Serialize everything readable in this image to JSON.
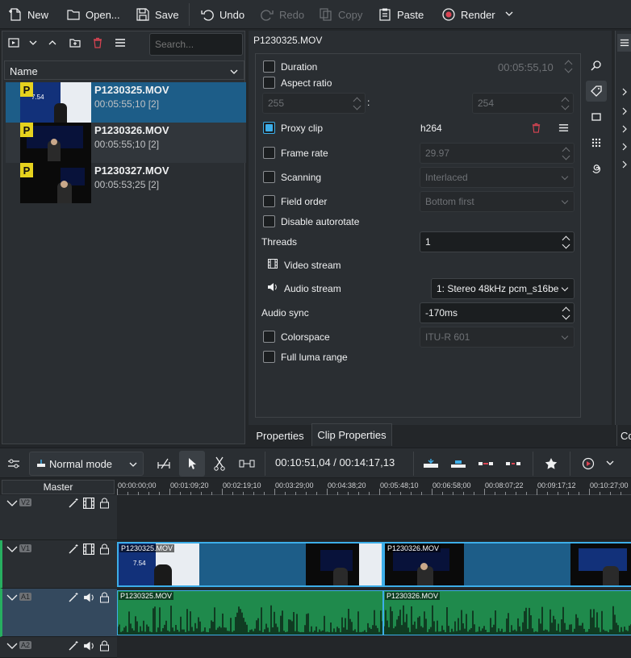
{
  "toolbar": {
    "new": "New",
    "open": "Open...",
    "save": "Save",
    "undo": "Undo",
    "redo": "Redo",
    "copy": "Copy",
    "paste": "Paste",
    "render": "Render"
  },
  "bin": {
    "search_placeholder": "Search...",
    "column_name": "Name",
    "items": [
      {
        "name": "P1230325.MOV",
        "duration": "00:05:55;10 [2]",
        "badge": "P",
        "thumb_text": "7.54"
      },
      {
        "name": "P1230326.MOV",
        "duration": "00:05:55;10 [2]",
        "badge": "P",
        "thumb_text": ""
      },
      {
        "name": "P1230327.MOV",
        "duration": "00:05:53;25 [2]",
        "badge": "P",
        "thumb_text": ""
      }
    ]
  },
  "props": {
    "title": "P1230325.MOV",
    "duration_label": "Duration",
    "duration_value": "00:05:55,10",
    "aspect_label": "Aspect ratio",
    "aspect_w": "255",
    "aspect_sep": ":",
    "aspect_h": "254",
    "proxy_label": "Proxy clip",
    "proxy_value": "h264",
    "framerate_label": "Frame rate",
    "framerate_value": "29.97",
    "scanning_label": "Scanning",
    "scanning_value": "Interlaced",
    "fieldorder_label": "Field order",
    "fieldorder_value": "Bottom first",
    "autorotate_label": "Disable autorotate",
    "threads_label": "Threads",
    "threads_value": "1",
    "video_stream_label": "Video stream",
    "audio_stream_label": "Audio stream",
    "audio_stream_value": "1: Stereo 48kHz pcm_s16be",
    "audio_sync_label": "Audio sync",
    "audio_sync_value": "-170ms",
    "colorspace_label": "Colorspace",
    "colorspace_value": "ITU-R 601",
    "luma_label": "Full luma range",
    "tab_properties": "Properties",
    "tab_clip_properties": "Clip Properties",
    "tab_right_partial": "Co"
  },
  "timeline": {
    "mode": "Normal mode",
    "timecode": "00:10:51,04 / 00:14:17,13",
    "master": "Master",
    "ruler": [
      "00:00:00;00",
      "00:01:09;20",
      "00:02:19;10",
      "00:03:29;00",
      "00:04:38;20",
      "00:05:48;10",
      "00:06:58;00",
      "00:08:07;22",
      "00:09:17;12",
      "00:10:27;00"
    ],
    "tracks": [
      {
        "id": "V2"
      },
      {
        "id": "V1"
      },
      {
        "id": "A1"
      },
      {
        "id": "A2"
      }
    ],
    "clips": {
      "v1_a": "P1230325.MOV",
      "v1_b": "P1230326.MOV",
      "a1_a": "P1230325.MOV",
      "a1_b": "P1230326.MOV"
    }
  },
  "colors": {
    "accent": "#3daee9",
    "video_clip": "#1d5d88",
    "audio_clip": "#1f8a4c",
    "badge": "#e6d21e"
  }
}
